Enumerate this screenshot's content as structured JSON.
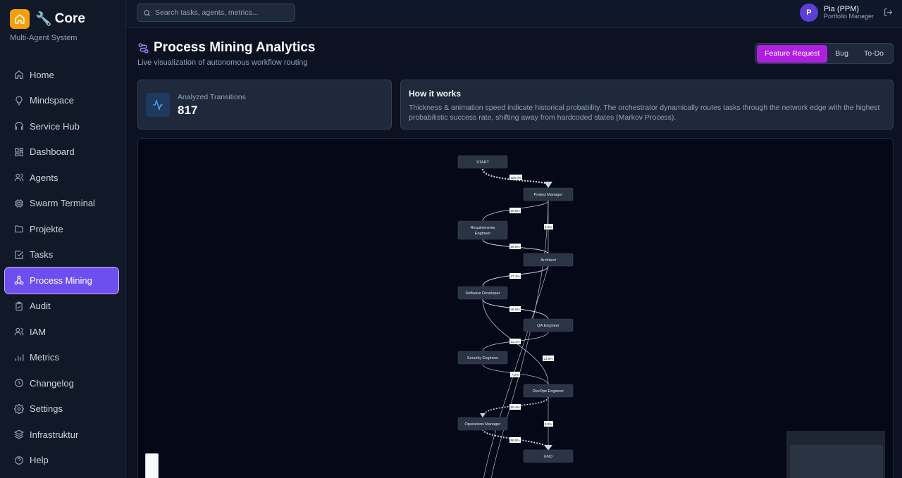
{
  "brand": {
    "title": "Core",
    "subtitle": "Multi-Agent System"
  },
  "search": {
    "placeholder": "Search tasks, agents, metrics..."
  },
  "user": {
    "initial": "P",
    "name": "Pia (PPM)",
    "role": "Portfolio Manager"
  },
  "nav": [
    {
      "label": "Home",
      "icon": "home-icon"
    },
    {
      "label": "Mindspace",
      "icon": "lightbulb-icon"
    },
    {
      "label": "Service Hub",
      "icon": "headset-icon"
    },
    {
      "label": "Dashboard",
      "icon": "grid-icon"
    },
    {
      "label": "Agents",
      "icon": "users-icon"
    },
    {
      "label": "Swarm Terminal",
      "icon": "cpu-icon"
    },
    {
      "label": "Projekte",
      "icon": "folder-icon"
    },
    {
      "label": "Tasks",
      "icon": "checkbox-icon"
    },
    {
      "label": "Process Mining",
      "icon": "network-icon",
      "active": true
    },
    {
      "label": "Audit",
      "icon": "clipboard-icon"
    },
    {
      "label": "IAM",
      "icon": "users-icon"
    },
    {
      "label": "Metrics",
      "icon": "bar-chart-icon"
    },
    {
      "label": "Changelog",
      "icon": "clock-icon"
    },
    {
      "label": "Settings",
      "icon": "gear-icon"
    },
    {
      "label": "Infrastruktur",
      "icon": "layers-icon"
    },
    {
      "label": "Help",
      "icon": "help-icon"
    }
  ],
  "page": {
    "title": "Process Mining Analytics",
    "subtitle": "Live visualization of autonomous workflow routing"
  },
  "tabs": [
    {
      "label": "Feature Request",
      "active": true
    },
    {
      "label": "Bug"
    },
    {
      "label": "To-Do"
    }
  ],
  "stats": {
    "label": "Analyzed Transitions",
    "value": "817"
  },
  "how_it_works": {
    "title": "How it works",
    "text": "Thickness & animation speed indicate historical probability. The orchestrator dynamically routes tasks through the network edge with the highest probabilistic success rate, shifting away from hardcoded states (Markov Process)."
  },
  "graph": {
    "nodes": [
      {
        "id": "start",
        "label": "START"
      },
      {
        "id": "pm",
        "label": "Project Manager"
      },
      {
        "id": "re",
        "label": "Requirements Engineer"
      },
      {
        "id": "arch",
        "label": "Architect"
      },
      {
        "id": "sd",
        "label": "Software Developer"
      },
      {
        "id": "qa",
        "label": "QA Engineer"
      },
      {
        "id": "sec",
        "label": "Security Engineer"
      },
      {
        "id": "devops",
        "label": "DevOps Engineer"
      },
      {
        "id": "ops",
        "label": "Operations Manager"
      },
      {
        "id": "end",
        "label": "END"
      }
    ],
    "edges": [
      {
        "label": "100.0%"
      },
      {
        "label": "20.6%"
      },
      {
        "label": "3.5%"
      },
      {
        "label": "96.5%"
      },
      {
        "label": "47.4%"
      },
      {
        "label": "46.6%"
      },
      {
        "label": "13.1%"
      },
      {
        "label": "23.5%"
      },
      {
        "label": "7.2%"
      },
      {
        "label": "60.4%"
      },
      {
        "label": "3.0%"
      },
      {
        "label": "86.8%"
      }
    ]
  }
}
